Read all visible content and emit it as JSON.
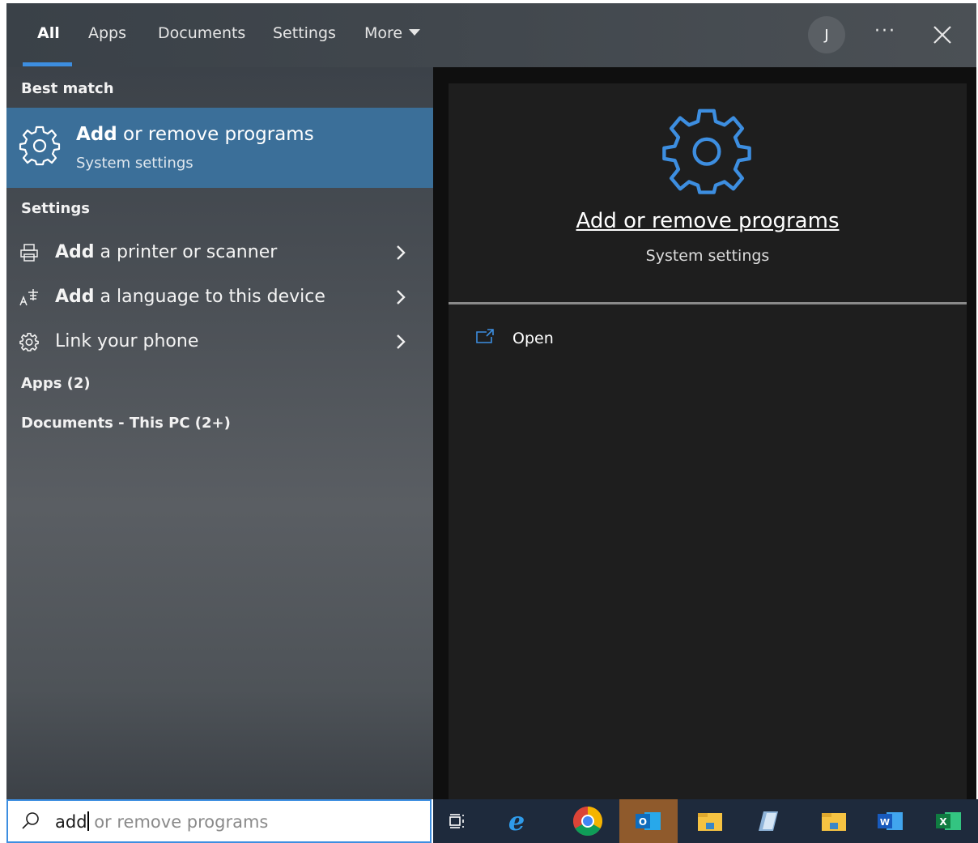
{
  "tabs": [
    {
      "label": "All",
      "active": true
    },
    {
      "label": "Apps"
    },
    {
      "label": "Documents"
    },
    {
      "label": "Settings"
    },
    {
      "label": "More"
    }
  ],
  "header": {
    "avatar_initial": "J",
    "more_options": "···",
    "close_icon": "close-icon"
  },
  "best_match": {
    "section_label": "Best match",
    "title_bold": "Add",
    "title_rest": " or remove programs",
    "subtitle": "System settings",
    "icon": "gear-icon"
  },
  "settings": {
    "section_label": "Settings",
    "items": [
      {
        "bold": "Add",
        "rest": " a printer or scanner",
        "icon": "printer-icon"
      },
      {
        "bold": "Add",
        "rest": " a language to this device",
        "icon": "language-icon"
      },
      {
        "bold": "",
        "rest": "Link your phone",
        "icon": "gear-small-icon"
      }
    ]
  },
  "apps_label": "Apps (2)",
  "documents_label": "Documents - This PC (2+)",
  "detail": {
    "title": "Add or remove programs",
    "subtitle": "System settings",
    "open_label": "Open",
    "accent_color": "#3d8ee0"
  },
  "search": {
    "typed": "add",
    "suggestion": " or remove programs"
  },
  "taskbar": {
    "items": [
      "task-view-icon",
      "edge-icon",
      "chrome-icon",
      "outlook-icon",
      "file-explorer-icon",
      "notes-icon",
      "folder-icon",
      "word-icon",
      "excel-icon"
    ]
  },
  "colors": {
    "highlight": "#3b6f99",
    "accent": "#3d8ee0",
    "taskbar": "#1e2a3c"
  }
}
